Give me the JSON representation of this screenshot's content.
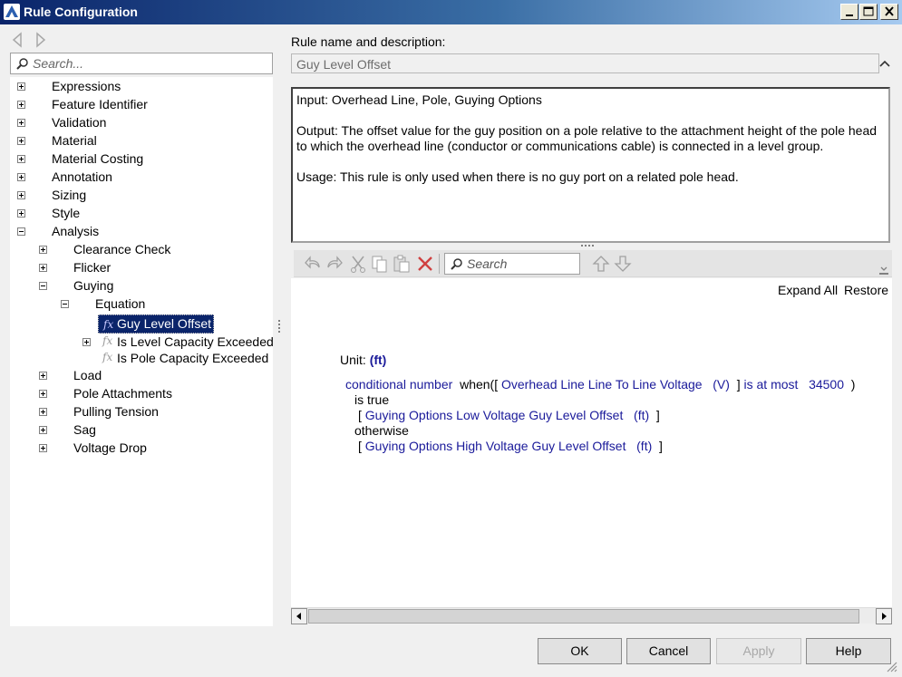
{
  "window": {
    "title": "Rule Configuration"
  },
  "left": {
    "search_placeholder": "Search...",
    "tree": {
      "expressions": "Expressions",
      "feature_identifier": "Feature Identifier",
      "validation": "Validation",
      "material": "Material",
      "material_costing": "Material Costing",
      "annotation": "Annotation",
      "sizing": "Sizing",
      "style": "Style",
      "analysis": "Analysis",
      "clearance_check": "Clearance Check",
      "flicker": "Flicker",
      "guying": "Guying",
      "equation": "Equation",
      "guy_level_offset": "Guy Level Offset",
      "is_level_capacity_exceeded": "Is Level Capacity Exceeded",
      "is_pole_capacity_exceeded": "Is Pole Capacity Exceeded",
      "load": "Load",
      "pole_attachments": "Pole Attachments",
      "pulling_tension": "Pulling Tension",
      "sag": "Sag",
      "voltage_drop": "Voltage Drop",
      "fx_glyph": "fx"
    }
  },
  "right": {
    "name_desc_label": "Rule name and description:",
    "rule_name": "Guy Level Offset",
    "description": {
      "input": "Input: Overhead Line, Pole, Guying Options",
      "output": "Output: The offset value for the guy position on a pole relative to the attachment height of the pole head to which the overhead line (conductor or communications cable) is connected in a level group.",
      "usage": "Usage: This rule is only used when there is no guy port on a related pole head."
    },
    "toolbar": {
      "search_placeholder": "Search"
    },
    "editor": {
      "expand_all": "Expand All",
      "restore": "Restore",
      "unit_label": "Unit:",
      "unit_value": "(ft)",
      "line1": {
        "conditional": "conditional number",
        "when": "when([",
        "attr": "Overhead Line Line To Line Voltage",
        "unit": "(V)",
        "close": "]",
        "op": "is at most",
        "value": "34500",
        "paren": ")"
      },
      "is_true": "is true",
      "line3": {
        "open": "[",
        "attr": "Guying Options Low Voltage Guy Level Offset",
        "unit": "(ft)",
        "close": "]"
      },
      "otherwise": "otherwise",
      "line5": {
        "open": "[",
        "attr": "Guying Options High Voltage Guy Level Offset",
        "unit": "(ft)",
        "close": "]"
      }
    }
  },
  "buttons": {
    "ok": "OK",
    "cancel": "Cancel",
    "apply": "Apply",
    "help": "Help"
  },
  "colors": {
    "titlebar_start": "#0a246a",
    "selection": "#0a246a",
    "keyword": "#1a1a9a",
    "delete_icon": "#d04040"
  }
}
